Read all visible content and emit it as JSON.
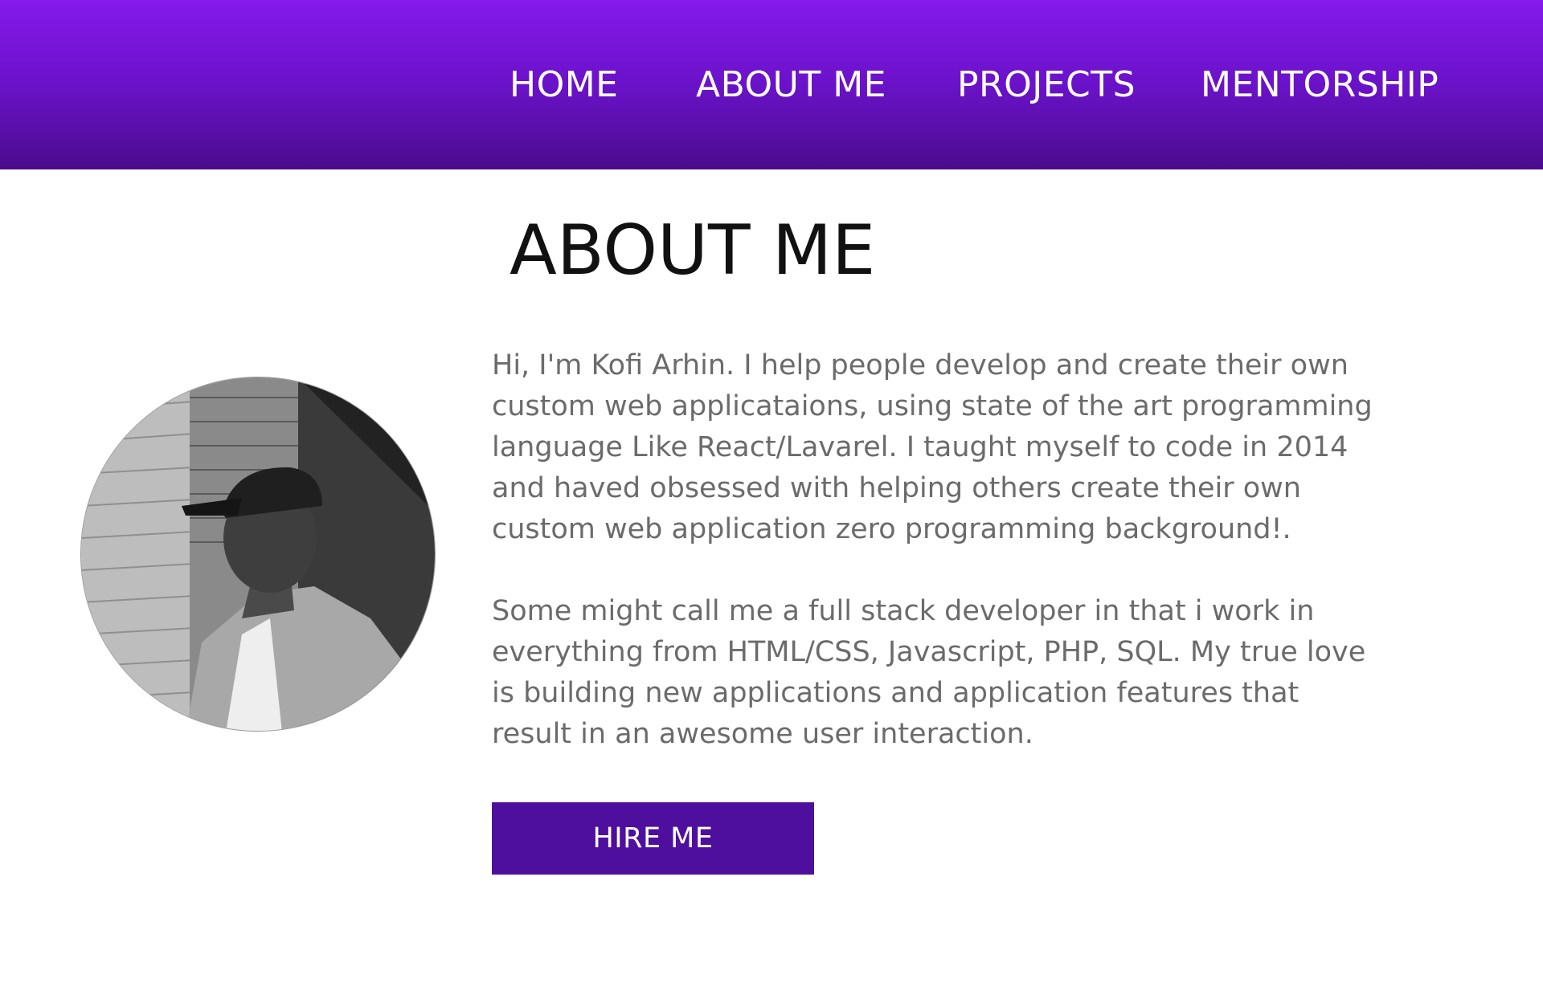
{
  "nav": {
    "items": [
      {
        "label": "HOME"
      },
      {
        "label": "ABOUT ME"
      },
      {
        "label": "PROJECTS"
      },
      {
        "label": "MENTORSHIP"
      }
    ]
  },
  "main": {
    "title": "ABOUT ME",
    "bio": [
      "Hi, I'm Kofi Arhin. I help people develop and create their own custom web applicataions, using state of the art programming language Like React/Lavarel. I taught myself to code in 2014 and haved obsessed with helping others create their own custom web application zero programming background!.",
      "Some might call me a full stack developer in that i work in everything from HTML/CSS, Javascript, PHP, SQL. My true love is building new applications and application features that result in an awesome user interaction."
    ],
    "cta_label": "HIRE ME"
  },
  "colors": {
    "nav_gradient_top": "#8619ec",
    "nav_gradient_bottom": "#4a0c8c",
    "button": "#4f0f9e",
    "bio_text": "#6b6b6b"
  },
  "icons": {
    "avatar": "profile-photo"
  }
}
